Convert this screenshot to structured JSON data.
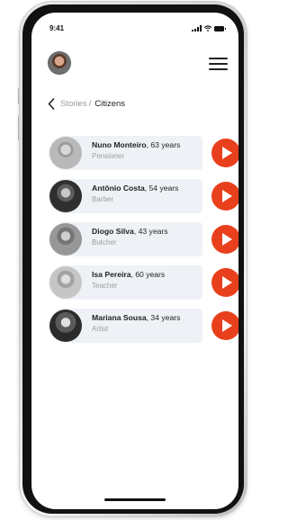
{
  "status_bar": {
    "time": "9:41"
  },
  "header": {
    "avatar_alt": "user-avatar",
    "menu_icon": "hamburger-menu-icon"
  },
  "breadcrumb": {
    "back_icon": "chevron-left-icon",
    "parent": "Stories",
    "separator": "/",
    "current": "Citizens"
  },
  "citizens": [
    {
      "name": "Nuno Monteiro",
      "age": ", 63 years",
      "role": "Pensioner"
    },
    {
      "name": "Antônio Costa",
      "age": ", 54 years",
      "role": "Barber"
    },
    {
      "name": "Diogo Silva",
      "age": ", 43 years",
      "role": "Butcher"
    },
    {
      "name": "Isa Pereira",
      "age": ", 60 years",
      "role": "Teacher"
    },
    {
      "name": "Mariana Sousa",
      "age": ", 34 years",
      "role": "Artist"
    }
  ],
  "colors": {
    "accent": "#e8401c",
    "row_background": "#eef1f5"
  }
}
